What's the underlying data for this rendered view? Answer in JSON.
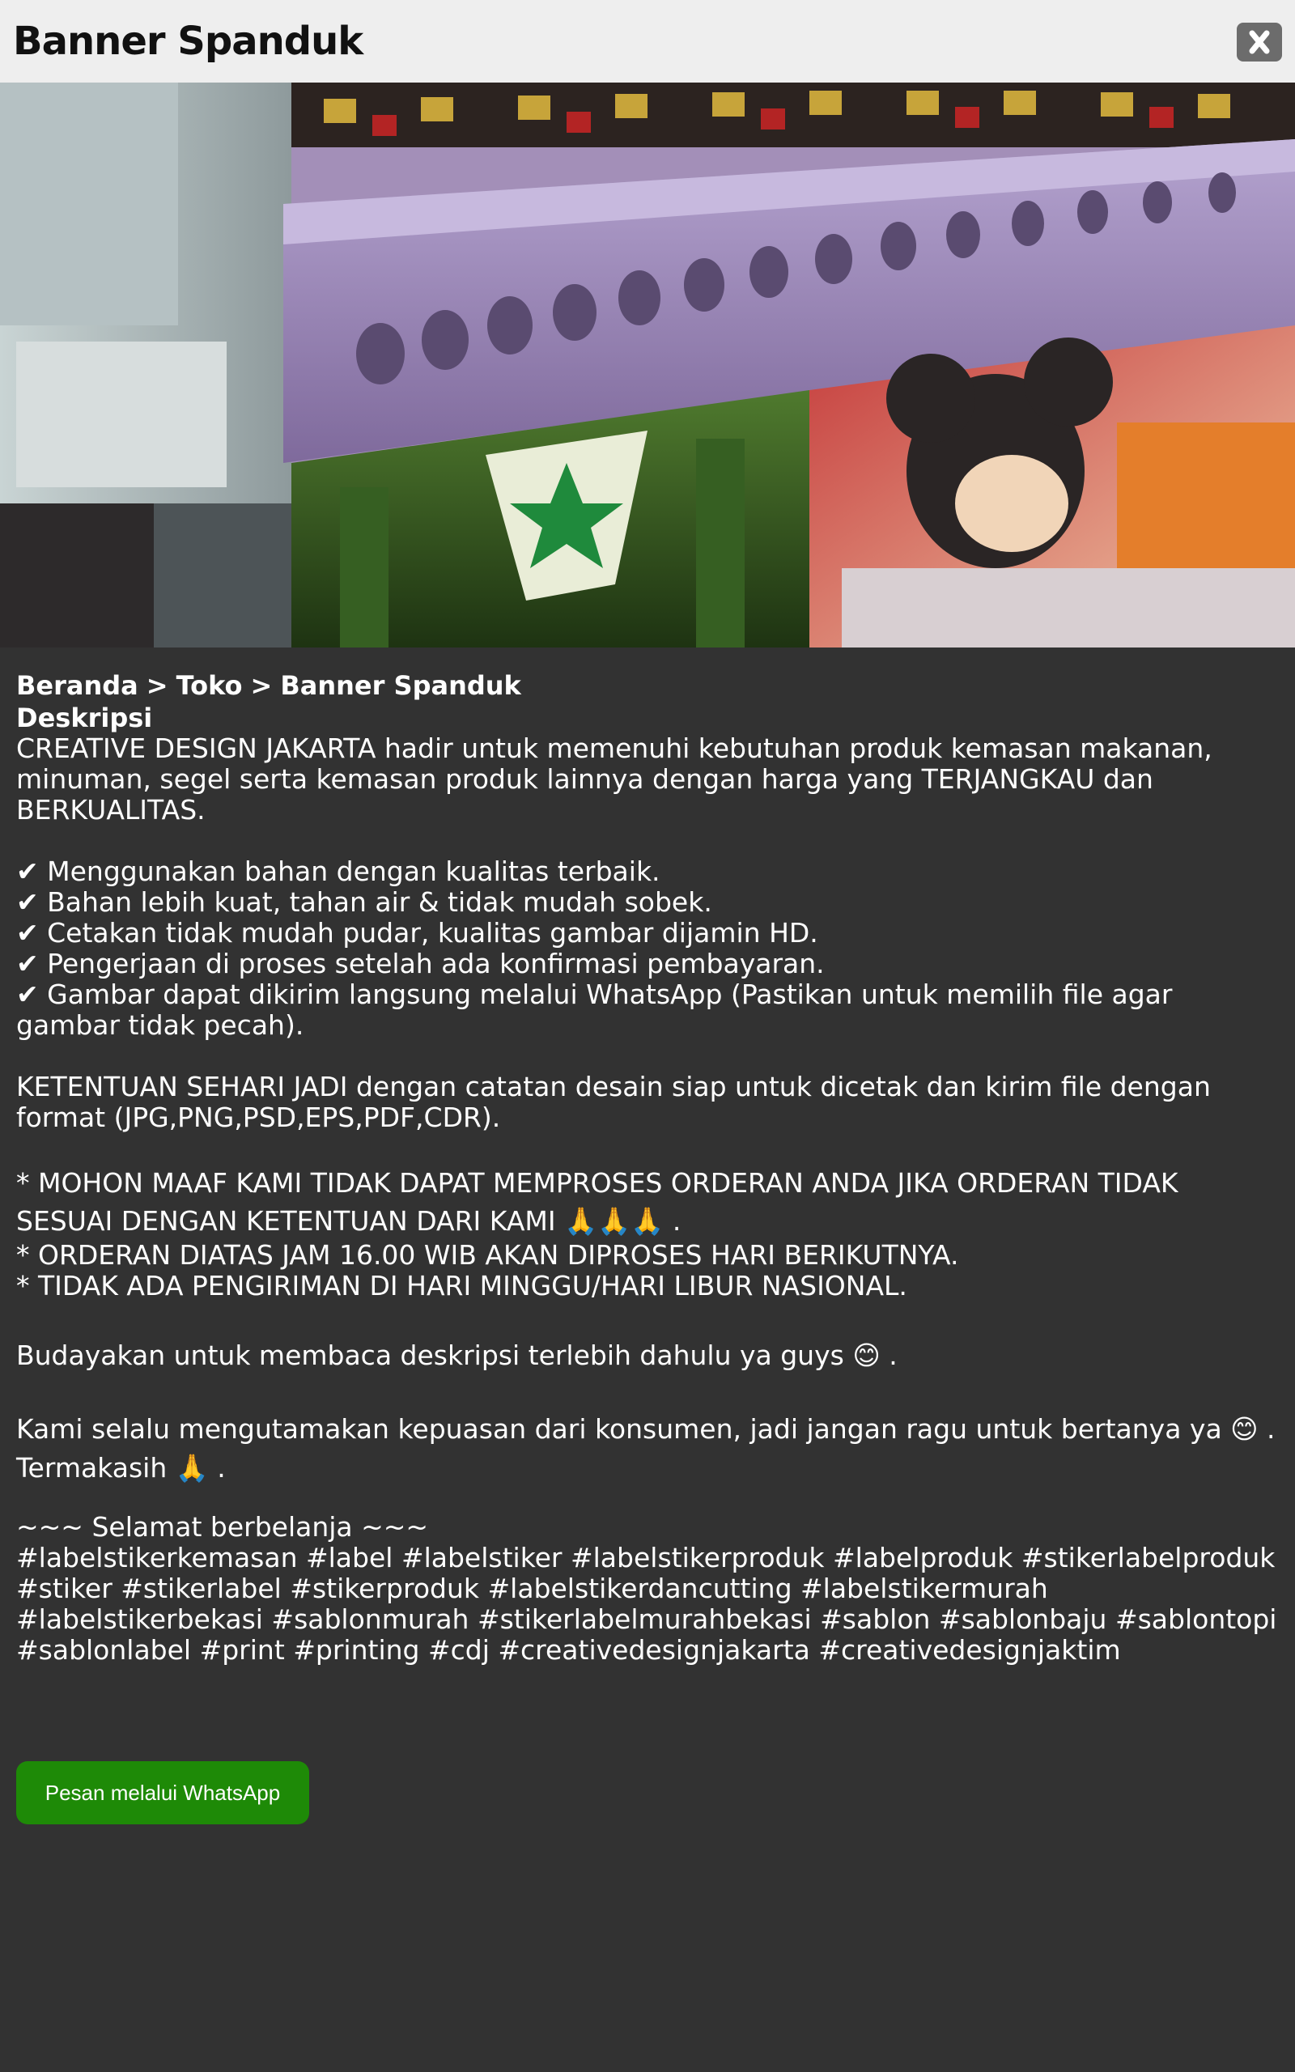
{
  "header": {
    "title": "Banner Spanduk",
    "close_icon": "close-icon"
  },
  "hero": {
    "description": "photo-of-large-format-printer"
  },
  "breadcrumb": {
    "items": [
      "Beranda",
      "Toko",
      "Banner Spanduk"
    ],
    "separator": ">"
  },
  "description": {
    "heading": "Deskripsi",
    "intro": "CREATIVE DESIGN JAKARTA hadir untuk memenuhi kebutuhan produk kemasan makanan, minuman, segel serta kemasan produk lainnya dengan harga yang TERJANGKAU dan BERKUALITAS.",
    "features": [
      "✔ Menggunakan bahan dengan kualitas terbaik.",
      "✔ Bahan lebih kuat, tahan air & tidak mudah sobek.",
      "✔ Cetakan tidak mudah pudar, kualitas gambar dijamin HD.",
      "✔ Pengerjaan di proses setelah ada konfirmasi pembayaran.",
      "✔ Gambar dapat dikirim langsung melalui WhatsApp (Pastikan untuk memilih file agar gambar tidak pecah)."
    ],
    "terms": "KETENTUAN SEHARI JADI dengan catatan desain siap untuk dicetak dan kirim file dengan format (JPG,PNG,PSD,EPS,PDF,CDR).",
    "notes": [
      "* MOHON MAAF KAMI TIDAK DAPAT MEMPROSES ORDERAN ANDA JIKA ORDERAN TIDAK SESUAI DENGAN KETENTUAN DARI KAMI 🙏🙏🙏 .",
      "* ORDERAN DIATAS JAM 16.00 WIB AKAN DIPROSES HARI BERIKUTNYA.",
      "* TIDAK ADA PENGIRIMAN DI HARI MINGGU/HARI LIBUR NASIONAL."
    ],
    "read_note": "Budayakan untuk membaca deskripsi terlebih dahulu ya guys 😊 .",
    "satisfaction": "Kami selalu mengutamakan kepuasan dari konsumen, jadi jangan ragu untuk bertanya ya 😊 .",
    "thanks": "Termakasih 🙏 .",
    "greeting": "~~~ Selamat berbelanja ~~~",
    "hashtags": "#labelstikerkemasan #label #labelstiker #labelstikerproduk #labelproduk #stikerlabelproduk #stiker #stikerlabel #stikerproduk #labelstikerdancutting #labelstikermurah #labelstikerbekasi #sablonmurah #stikerlabelmurahbekasi #sablon #sablonbaju #sablontopi #sablonlabel #print #printing #cdj #creativedesignjakarta #creativedesignjaktim"
  },
  "actions": {
    "whatsapp_label": "Pesan melalui WhatsApp"
  },
  "colors": {
    "background": "#323232",
    "header_bg": "#eeeeee",
    "button_green": "#1e8a07",
    "close_bg": "#6c6c6c"
  }
}
